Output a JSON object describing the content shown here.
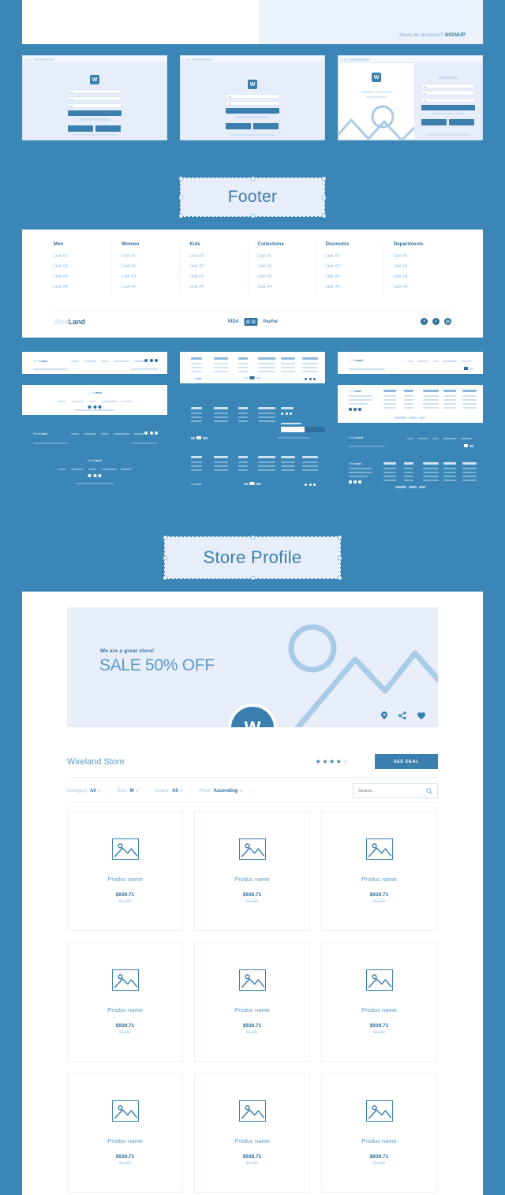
{
  "colors": {
    "background": "#3a87b7",
    "panel": "#e7eefa",
    "accent": "#3a7fae",
    "text_dark": "#2e6f9e",
    "text_light": "#86b5d9",
    "line": "#b9d4ea"
  },
  "top_screen": {
    "have_account_text": "Have an account?",
    "signup_link": "SIGNUP"
  },
  "login_thumbnails": {
    "items": [
      {
        "name": "signup-form-centered"
      },
      {
        "name": "login-form-centered"
      },
      {
        "name": "signup-split-screen"
      }
    ],
    "split": {
      "welcome_line1": "Welcome to Wireland",
      "welcome_line2": "for businesses",
      "logo_letter": "W"
    }
  },
  "sections": [
    {
      "label": "Footer"
    },
    {
      "label": "Store Profile"
    }
  ],
  "footer": {
    "columns": [
      {
        "title": "Men",
        "links": [
          "Link #1",
          "Link #2",
          "Link #3",
          "Link #4"
        ]
      },
      {
        "title": "Women",
        "links": [
          "Link #1",
          "Link #2",
          "Link #3",
          "Link #4"
        ]
      },
      {
        "title": "Kids",
        "links": [
          "Link #1",
          "Link #2",
          "Link #3",
          "Link #4"
        ]
      },
      {
        "title": "Collections",
        "links": [
          "Link #1",
          "Link #2",
          "Link #3",
          "Link #4"
        ]
      },
      {
        "title": "Discounts",
        "links": [
          "Link #1",
          "Link #2",
          "Link #3",
          "Link #4"
        ]
      },
      {
        "title": "Departments",
        "links": [
          "Link #1",
          "Link #2",
          "Link #3",
          "Link #4"
        ]
      }
    ],
    "logo": {
      "part1": "Wire",
      "part2": "Land"
    },
    "payments": [
      {
        "name": "visa",
        "label": "VISA"
      },
      {
        "name": "mastercard",
        "label": ""
      },
      {
        "name": "paypal",
        "label": "PayPal"
      }
    ],
    "socials": [
      {
        "name": "facebook-icon",
        "glyph": "f"
      },
      {
        "name": "twitter-icon",
        "glyph": "✓"
      },
      {
        "name": "instagram-icon",
        "glyph": "◎"
      }
    ]
  },
  "store_profile": {
    "hero": {
      "kicker": "We are a great store!",
      "headline": "SALE 50% OFF",
      "avatar_letter": "W",
      "icons": [
        {
          "name": "location-pin-icon"
        },
        {
          "name": "share-icon"
        },
        {
          "name": "heart-icon"
        }
      ]
    },
    "store_name": "Wireland Store",
    "rating": {
      "filled": 4,
      "total": 5,
      "stars_filled": "★★★★",
      "star_empty": "★"
    },
    "see_deal_label": "SEE DEAL",
    "filters": [
      {
        "label": "Category:",
        "value": "All",
        "caret": "▾"
      },
      {
        "label": "Size:",
        "value": "M",
        "caret": "▾"
      },
      {
        "label": "Colors:",
        "value": "All",
        "caret": "▾"
      },
      {
        "label": "Price:",
        "value": "Ascending",
        "caret": "▾"
      }
    ],
    "search": {
      "placeholder": "Search...",
      "value": "",
      "icon": "search-icon"
    },
    "products": [
      {
        "name": "Produc name",
        "price": "$939.71",
        "old_price": "$1,100"
      },
      {
        "name": "Produc name",
        "price": "$939.71",
        "old_price": "$1,100"
      },
      {
        "name": "Produc name",
        "price": "$939.71",
        "old_price": "$1,100"
      },
      {
        "name": "Produc name",
        "price": "$939.71",
        "old_price": "$1,100"
      },
      {
        "name": "Produc name",
        "price": "$939.71",
        "old_price": "$1,100"
      },
      {
        "name": "Produc name",
        "price": "$939.71",
        "old_price": "$1,100"
      },
      {
        "name": "Produc name",
        "price": "$939.71",
        "old_price": "$1,100"
      },
      {
        "name": "Produc name",
        "price": "$939.71",
        "old_price": "$1,100"
      },
      {
        "name": "Produc name",
        "price": "$939.71",
        "old_price": "$1,100"
      }
    ]
  }
}
